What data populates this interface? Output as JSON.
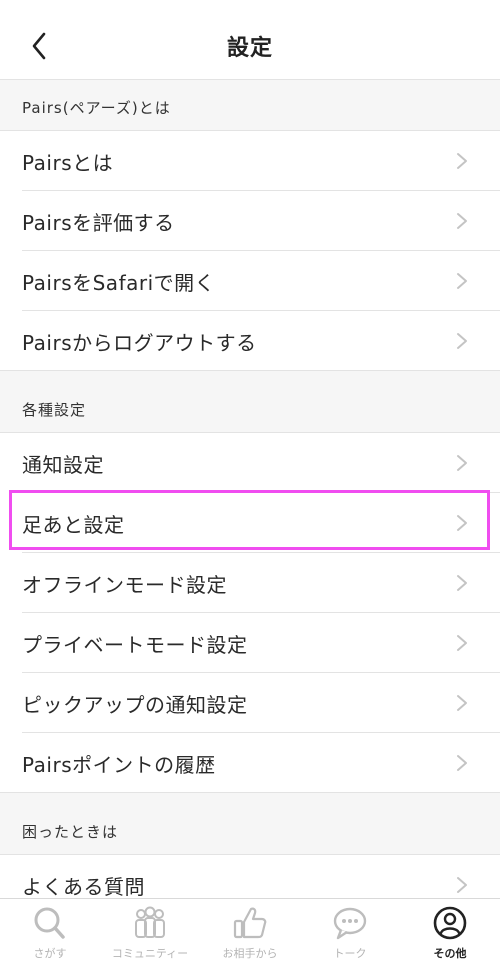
{
  "header": {
    "title": "設定"
  },
  "sections": [
    {
      "title": "Pairs(ペアーズ)とは",
      "items": [
        "Pairsとは",
        "Pairsを評価する",
        "PairsをSafariで開く",
        "Pairsからログアウトする"
      ]
    },
    {
      "title": "各種設定",
      "items": [
        "通知設定",
        "足あと設定",
        "オフラインモード設定",
        "プライベートモード設定",
        "ピックアップの通知設定",
        "Pairsポイントの履歴"
      ]
    },
    {
      "title": "困ったときは",
      "items": [
        "よくある質問"
      ]
    }
  ],
  "tabs": [
    {
      "label": "さがす",
      "icon": "search-icon"
    },
    {
      "label": "コミュニティー",
      "icon": "community-icon"
    },
    {
      "label": "お相手から",
      "icon": "thumbs-up-icon"
    },
    {
      "label": "トーク",
      "icon": "chat-bubble-icon"
    },
    {
      "label": "その他",
      "icon": "profile-icon",
      "active": true
    }
  ],
  "colors": {
    "highlight": "#f04df0",
    "separator": "#e3e3e3",
    "section_bg": "#f6f6f6",
    "chevron": "#c4c4c4",
    "tab_inactive": "#b4b4b4"
  }
}
